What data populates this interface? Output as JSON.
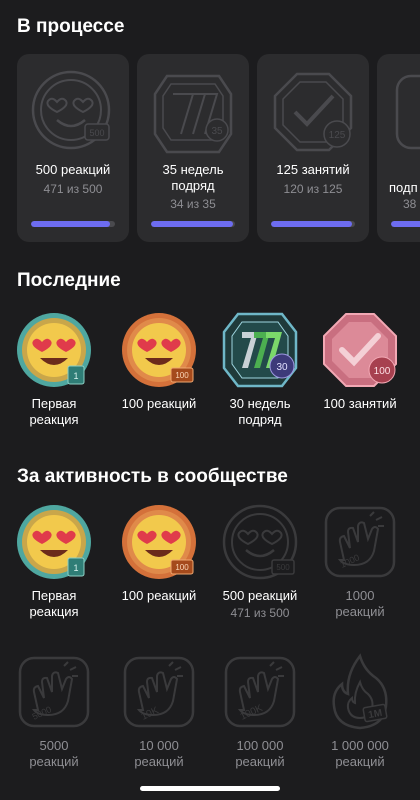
{
  "sections": {
    "in_progress": "В процессе",
    "recent": "Последние",
    "community": "За активность в сообществе"
  },
  "in_progress": [
    {
      "title": "500 реакций",
      "count": "471 из 500",
      "progress": 0.942,
      "icon": "emoji-heart-eyes-outline-icon",
      "tag": "500"
    },
    {
      "title": "35 недель подряд",
      "count": "34 из 35",
      "progress": 0.971,
      "icon": "seven-weeks-outline-icon",
      "tag": "35"
    },
    {
      "title": "125 занятий",
      "count": "120 из 125",
      "progress": 0.96,
      "icon": "checkmark-outline-icon",
      "tag": "125"
    },
    {
      "title": "подп",
      "count": "38",
      "progress": 0.5,
      "icon": "partial-badge-icon",
      "tag": ""
    }
  ],
  "recent": [
    {
      "label": "Первая реакция",
      "tag": "1",
      "icon": "emoji-heart-eyes-teal-icon"
    },
    {
      "label": "100 реакций",
      "tag": "100",
      "icon": "emoji-heart-eyes-bronze-icon"
    },
    {
      "label": "30 недель подряд",
      "tag": "30",
      "icon": "seven-green-icon"
    },
    {
      "label": "100 занятий",
      "tag": "100",
      "icon": "checkmark-pink-icon"
    }
  ],
  "community": [
    {
      "label": "Первая реакция",
      "sub": "",
      "tag": "1",
      "icon": "emoji-heart-eyes-teal-icon",
      "earned": true
    },
    {
      "label": "100 реакций",
      "sub": "",
      "tag": "100",
      "icon": "emoji-heart-eyes-bronze-icon",
      "earned": true
    },
    {
      "label": "500 реакций",
      "sub": "471 из 500",
      "tag": "500",
      "icon": "emoji-heart-eyes-outline-icon",
      "earned": false
    },
    {
      "label": "1000 реакций",
      "sub": "",
      "tag": "1000",
      "icon": "clapping-hands-outline-icon",
      "earned": false
    },
    {
      "label": "5000 реакций",
      "sub": "",
      "tag": "5000",
      "icon": "clapping-hands-outline-icon",
      "earned": false
    },
    {
      "label": "10 000 реакций",
      "sub": "",
      "tag": "10K",
      "icon": "clapping-hands-outline-icon",
      "earned": false
    },
    {
      "label": "100 000 реакций",
      "sub": "",
      "tag": "100K",
      "icon": "clapping-hands-outline-icon",
      "earned": false
    },
    {
      "label": "1 000 000 реакций",
      "sub": "",
      "tag": "1M",
      "icon": "flame-outline-icon",
      "earned": false
    }
  ],
  "colors": {
    "background": "#1c1c1e",
    "card": "#2c2c2e",
    "progress_fill": "#6d6cf0",
    "muted_text": "#8e8e93"
  }
}
